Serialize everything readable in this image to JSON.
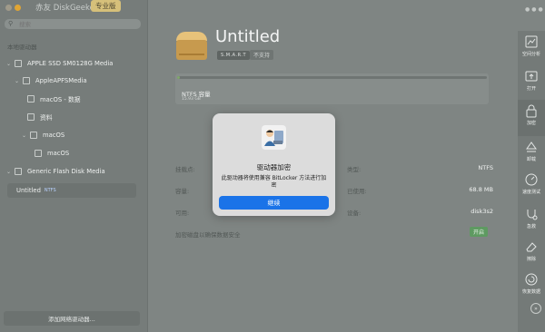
{
  "app": {
    "title": "赤友 DiskGeeker",
    "pro_badge": "专业版"
  },
  "sidebar": {
    "search_placeholder": "搜索",
    "section_label": "本地驱动器",
    "items": [
      {
        "label": "APPLE SSD SM0128G Media"
      },
      {
        "label": "AppleAPFSMedia"
      },
      {
        "label": "macOS - 数据"
      },
      {
        "label": "资料"
      },
      {
        "label": "macOS"
      },
      {
        "label": "macOS"
      },
      {
        "label": "Generic Flash Disk Media"
      },
      {
        "label": "Untitled",
        "tag": "NTFS"
      }
    ],
    "add_network_label": "添加网络驱动器..."
  },
  "volume": {
    "title": "Untitled",
    "smart_label": "S.M.A.R.T",
    "smart_status": "不支持",
    "usage_label": "NTFS 容量",
    "usage_size": "15.93 GB",
    "usage_fraction": 0.004
  },
  "info": {
    "mount_label": "挂载点:",
    "type_label": "类型:",
    "type_value": "NTFS",
    "capacity_label": "容量:",
    "used_label": "已使用:",
    "used_value": "68.8 MB",
    "available_label": "可用:",
    "device_label": "设备:",
    "device_value": "disk3s2",
    "encrypt_label": "加密磁盘以确保数据安全",
    "encrypt_state": "开启"
  },
  "toolbar": {
    "items": [
      {
        "label": "空间分析",
        "icon": "space-analysis-icon"
      },
      {
        "label": "打开",
        "icon": "open-icon"
      },
      {
        "label": "加密",
        "icon": "lock-icon"
      },
      {
        "label": "卸载",
        "icon": "eject-icon"
      },
      {
        "label": "速度测试",
        "icon": "speed-test-icon"
      },
      {
        "label": "急救",
        "icon": "first-aid-icon"
      },
      {
        "label": "擦除",
        "icon": "erase-icon"
      },
      {
        "label": "恢复数据",
        "icon": "recover-data-icon"
      }
    ]
  },
  "dialog": {
    "title": "驱动器加密",
    "message": "此驱动器将使用兼容 BitLocker 方法进行加密",
    "button": "继续"
  },
  "colors": {
    "accent": "#1a73e8",
    "pro_badge": "#d6c07a",
    "on_badge": "#5e9a61",
    "drive": "#e7c27a"
  }
}
